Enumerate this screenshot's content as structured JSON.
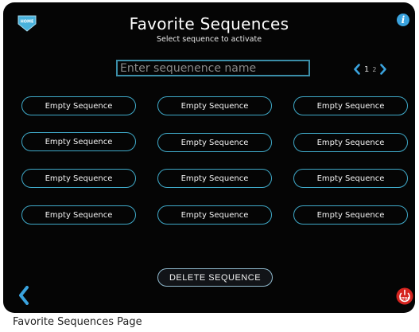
{
  "header": {
    "home_label": "HOME",
    "title": "Favorite Sequences",
    "subtitle": "Select sequence to activate",
    "info_glyph": "i"
  },
  "search": {
    "placeholder": "Enter sequenence name",
    "value": ""
  },
  "pager": {
    "pages": [
      "1",
      "2"
    ],
    "current_page": "1"
  },
  "sequences": [
    "Empty Sequence",
    "Empty Sequence",
    "Empty Sequence",
    "Empty Sequence",
    "Empty Sequence",
    "Empty Sequence",
    "Empty Sequence",
    "Empty Sequence",
    "Empty Sequence",
    "Empty Sequence",
    "Empty Sequence",
    "Empty Sequence"
  ],
  "footer": {
    "delete_label": "DELETE SEQUENCE",
    "stop_label": "STOP"
  },
  "caption": "Favorite Sequences Page",
  "colors": {
    "screen_bg": "#050505",
    "accent": "#3fa9c8",
    "info_blue": "#3aa3de",
    "stop_red": "#d6241f"
  },
  "icons": {
    "home": "home-shield-icon",
    "info": "info-icon",
    "prev_page": "chevron-left-icon",
    "next_page": "chevron-right-icon",
    "back": "back-chevron-icon",
    "stop": "power-stop-icon"
  }
}
